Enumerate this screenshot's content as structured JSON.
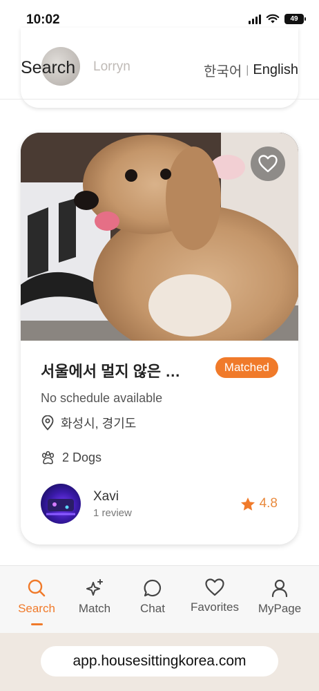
{
  "status_bar": {
    "time": "10:02",
    "battery": "49"
  },
  "header": {
    "title": "Search",
    "lang_ko": "한국어",
    "lang_sep": "|",
    "lang_en": "English"
  },
  "previous_card": {
    "name": "Lorryn"
  },
  "listing": {
    "title": "서울에서 멀지 않은 …",
    "badge": "Matched",
    "schedule": "No schedule available",
    "location": "화성시, 경기도",
    "dogs": "2 Dogs",
    "owner_name": "Xavi",
    "owner_reviews": "1 review",
    "rating": "4.8",
    "favorited": false
  },
  "nav": {
    "items": [
      {
        "label": "Search",
        "icon": "search-icon",
        "active": true
      },
      {
        "label": "Match",
        "icon": "sparkle-icon",
        "active": false
      },
      {
        "label": "Chat",
        "icon": "chat-bubble-icon",
        "active": false
      },
      {
        "label": "Favorites",
        "icon": "heart-icon",
        "active": false
      },
      {
        "label": "MyPage",
        "icon": "person-icon",
        "active": false
      }
    ]
  },
  "browser": {
    "url": "app.housesittingkorea.com"
  },
  "colors": {
    "accent": "#f07a2a",
    "rating": "#e98a3e",
    "star": "#f07a2a"
  }
}
